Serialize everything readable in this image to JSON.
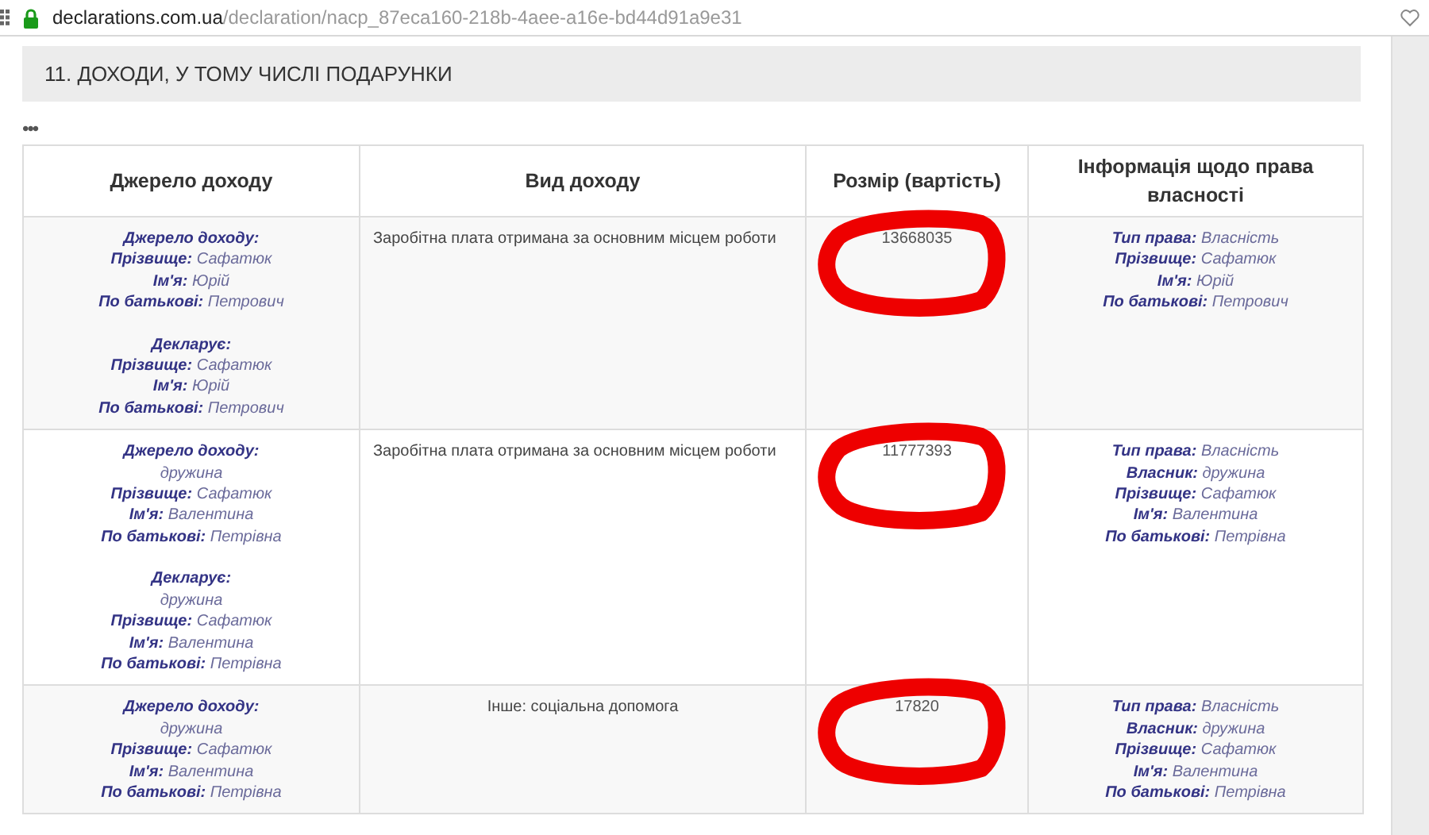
{
  "address_bar": {
    "domain": "declarations.com.ua",
    "path": "/declaration/nacp_87eca160-218b-4aee-a16e-bd44d91a9e31"
  },
  "section": {
    "title": "11.  ДОХОДИ, У ТОМУ ЧИСЛІ ПОДАРУНКИ",
    "more": "•••"
  },
  "table": {
    "columns": [
      "Джерело доходу",
      "Вид доходу",
      "Розмір (вартість)",
      "Інформація щодо права власності"
    ],
    "rows": [
      {
        "source": [
          [
            {
              "label": "Джерело доходу:"
            },
            {
              "label": "Прізвище:",
              "value": "Сафатюк"
            },
            {
              "label": "Ім'я:",
              "value": "Юрій"
            },
            {
              "label": "По батькові:",
              "value": "Петрович"
            }
          ],
          [
            {
              "label": "Декларує:"
            },
            {
              "label": "Прізвище:",
              "value": "Сафатюк"
            },
            {
              "label": "Ім'я:",
              "value": "Юрій"
            },
            {
              "label": "По батькові:",
              "value": "Петрович"
            }
          ]
        ],
        "income_type": "Заробітна плата отримана за основним місцем роботи",
        "centered": false,
        "amount": "13668035",
        "circled": true,
        "ownership": [
          {
            "label": "Тип права:",
            "value": "Власність"
          },
          {
            "label": "Прізвище:",
            "value": "Сафатюк"
          },
          {
            "label": "Ім'я:",
            "value": "Юрій"
          },
          {
            "label": "По батькові:",
            "value": "Петрович"
          }
        ]
      },
      {
        "source": [
          [
            {
              "label": "Джерело доходу:"
            },
            {
              "value": "дружина"
            },
            {
              "label": "Прізвище:",
              "value": "Сафатюк"
            },
            {
              "label": "Ім'я:",
              "value": "Валентина"
            },
            {
              "label": "По батькові:",
              "value": "Петрівна"
            }
          ],
          [
            {
              "label": "Декларує:"
            },
            {
              "value": "дружина"
            },
            {
              "label": "Прізвище:",
              "value": "Сафатюк"
            },
            {
              "label": "Ім'я:",
              "value": "Валентина"
            },
            {
              "label": "По батькові:",
              "value": "Петрівна"
            }
          ]
        ],
        "income_type": "Заробітна плата отримана за основним місцем роботи",
        "centered": false,
        "amount": "11777393",
        "circled": true,
        "ownership": [
          {
            "label": "Тип права:",
            "value": "Власність"
          },
          {
            "label": "Власник:",
            "value": "дружина"
          },
          {
            "label": "Прізвище:",
            "value": "Сафатюк"
          },
          {
            "label": "Ім'я:",
            "value": "Валентина"
          },
          {
            "label": "По батькові:",
            "value": "Петрівна"
          }
        ]
      },
      {
        "source": [
          [
            {
              "label": "Джерело доходу:"
            },
            {
              "value": "дружина"
            },
            {
              "label": "Прізвище:",
              "value": "Сафатюк"
            },
            {
              "label": "Ім'я:",
              "value": "Валентина"
            },
            {
              "label": "По батькові:",
              "value": "Петрівна"
            }
          ]
        ],
        "income_type": "Інше: соціальна допомога",
        "centered": true,
        "amount": "17820",
        "circled": true,
        "ownership": [
          {
            "label": "Тип права:",
            "value": "Власність"
          },
          {
            "label": "Власник:",
            "value": "дружина"
          },
          {
            "label": "Прізвище:",
            "value": "Сафатюк"
          },
          {
            "label": "Ім'я:",
            "value": "Валентина"
          },
          {
            "label": "По батькові:",
            "value": "Петрівна"
          }
        ]
      }
    ]
  }
}
